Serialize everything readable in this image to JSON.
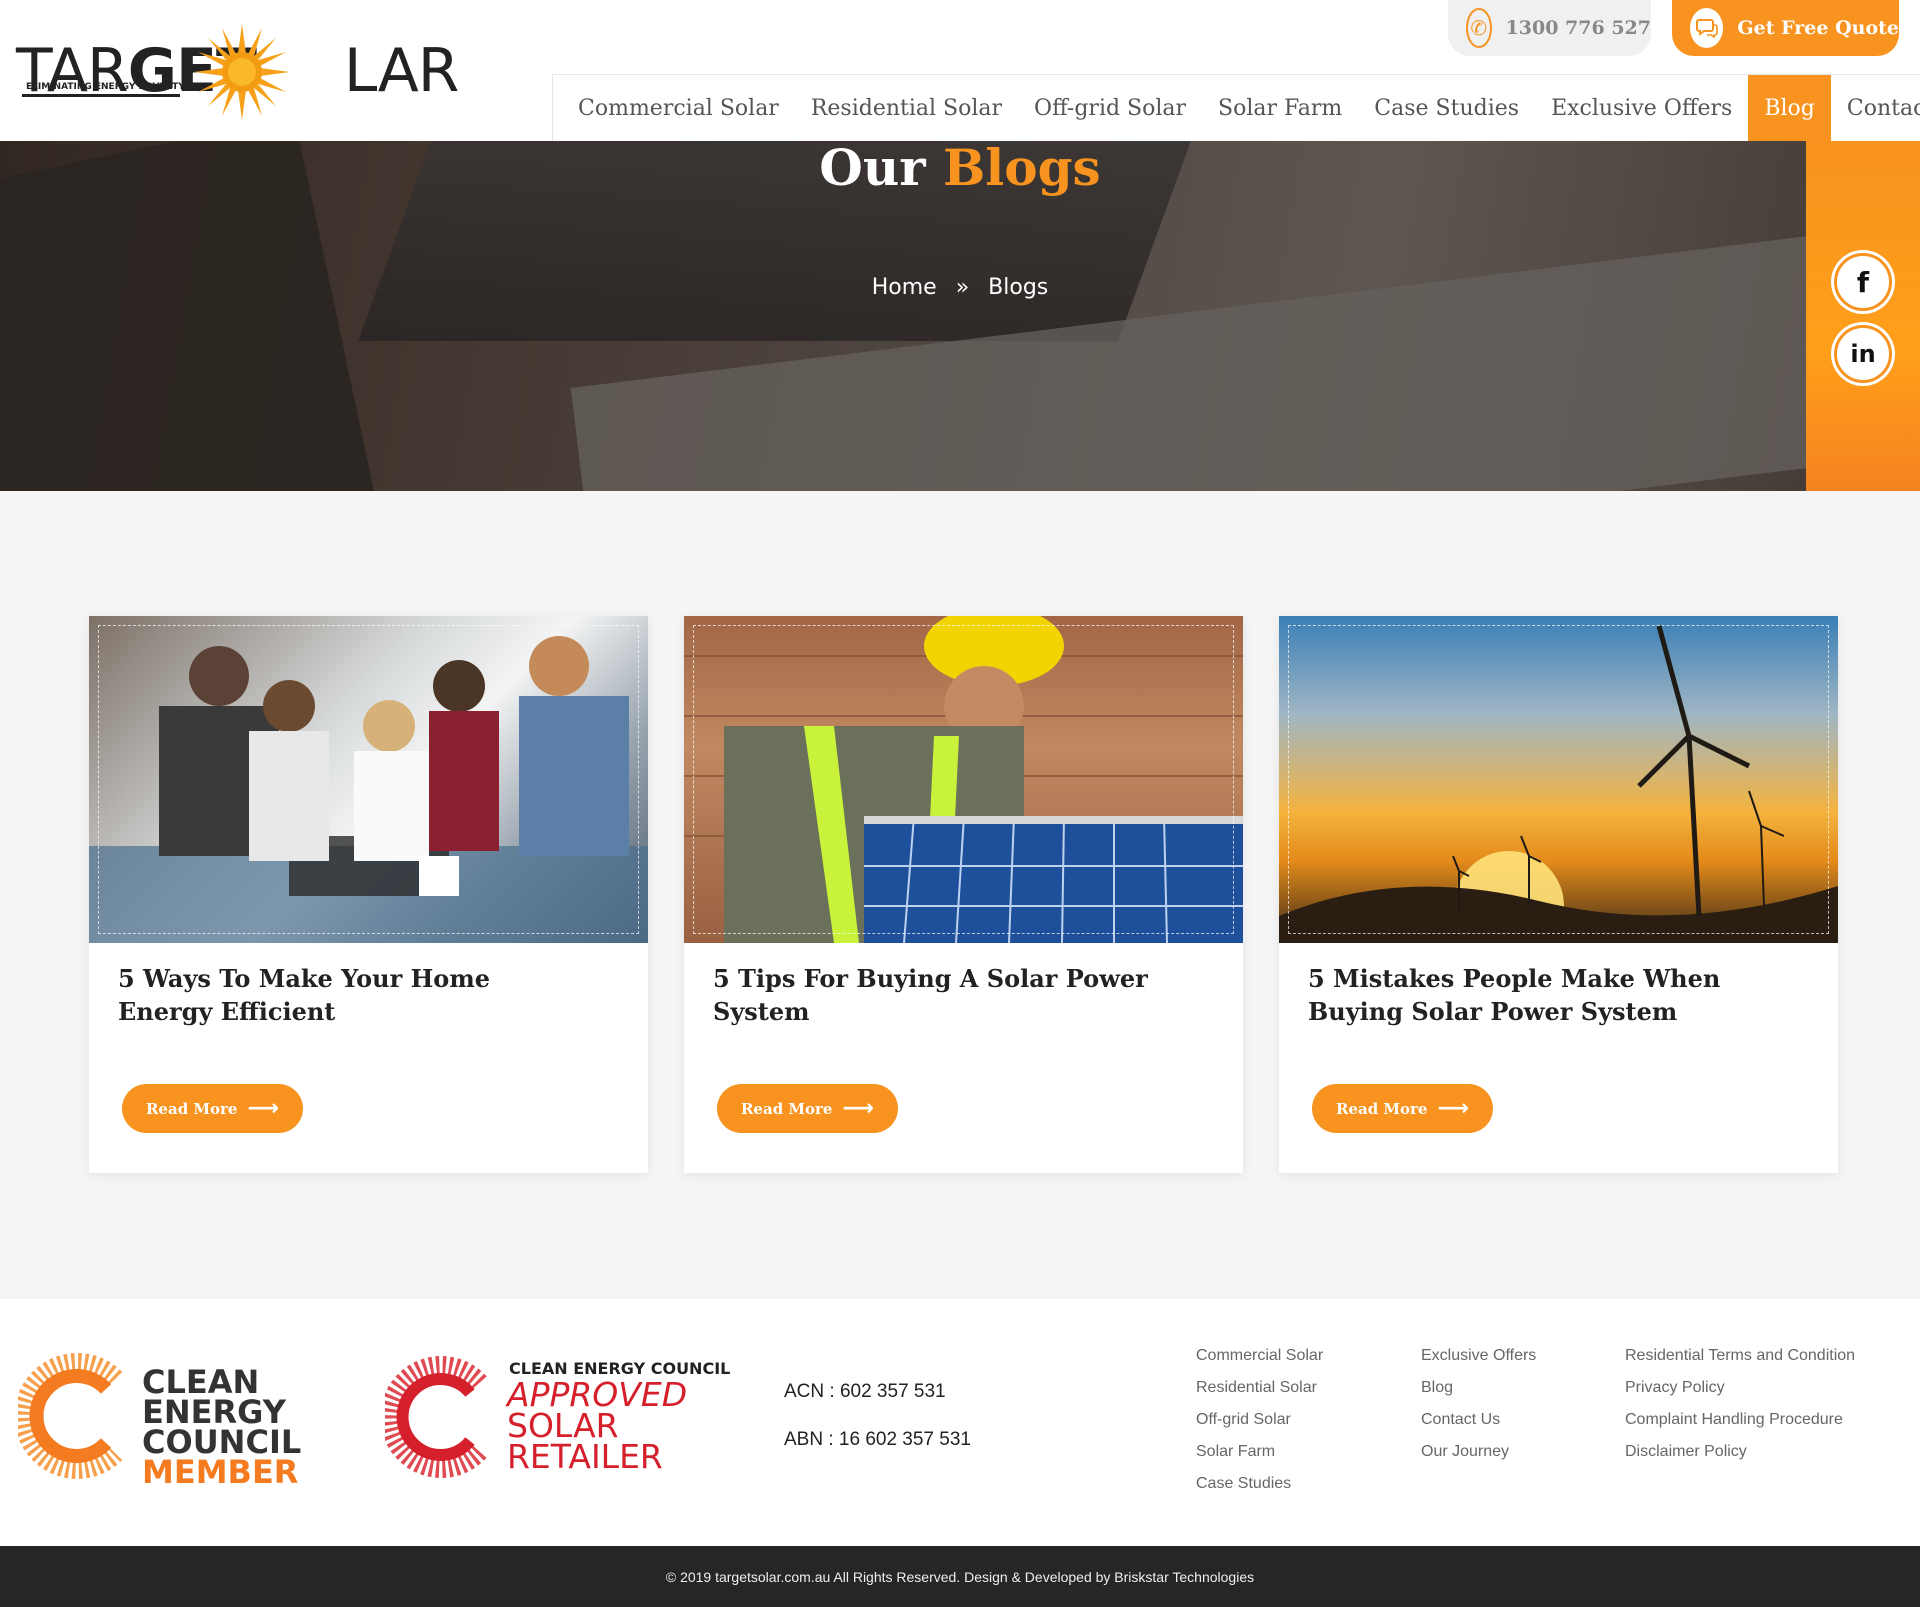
{
  "header": {
    "logo_text": "TARGETSOLAR",
    "logo_tagline": "ELIMINATING ENERGY POVERTY",
    "phone": "1300 776 527",
    "quote_label": "Get Free Quote"
  },
  "nav": {
    "items": [
      {
        "label": "Commercial Solar",
        "active": false
      },
      {
        "label": "Residential Solar",
        "active": false
      },
      {
        "label": "Off-grid Solar",
        "active": false
      },
      {
        "label": "Solar Farm",
        "active": false
      },
      {
        "label": "Case Studies",
        "active": false
      },
      {
        "label": "Exclusive Offers",
        "active": false
      },
      {
        "label": "Blog",
        "active": true
      },
      {
        "label": "Contact Us",
        "active": false
      }
    ]
  },
  "hero": {
    "title_main": "Our",
    "title_accent": "Blogs",
    "breadcrumb_home": "Home",
    "breadcrumb_separator": "»",
    "breadcrumb_current": "Blogs"
  },
  "social": {
    "facebook": "f",
    "linkedin": "in"
  },
  "cards": [
    {
      "title": "5 Ways To Make Your Home Energy Efficient",
      "button": "Read More"
    },
    {
      "title": "5 Tips For Buying A Solar Power System",
      "button": "Read More"
    },
    {
      "title": "5 Mistakes People Make When Buying Solar Power System",
      "button": "Read More"
    }
  ],
  "footer": {
    "cec_member": {
      "line1": "CLEAN",
      "line2": "ENERGY",
      "line3": "COUNCIL",
      "line4": "MEMBER"
    },
    "cec_approved": {
      "top": "CLEAN ENERGY COUNCIL",
      "line1": "APPROVED",
      "line2": "SOLAR",
      "line3": "RETAILER"
    },
    "acn": "ACN : 602 357 531",
    "abn": "ABN : 16 602 357 531",
    "links_col1": [
      "Commercial Solar",
      "Residential Solar",
      "Off-grid Solar",
      "Solar Farm",
      "Case Studies"
    ],
    "links_col2": [
      "Exclusive Offers",
      "Blog",
      "Contact Us",
      "Our Journey"
    ],
    "links_col3": [
      "Residential Terms and Condition",
      "Privacy Policy",
      "Complaint Handling Procedure",
      "Disclaimer Policy"
    ],
    "copyright": "© 2019 targetsolar.com.au All Rights Reserved. Design & Developed by Briskstar Technologies"
  },
  "colors": {
    "accent": "#f7931e",
    "dark": "#262626",
    "cec_red": "#d5202c"
  }
}
